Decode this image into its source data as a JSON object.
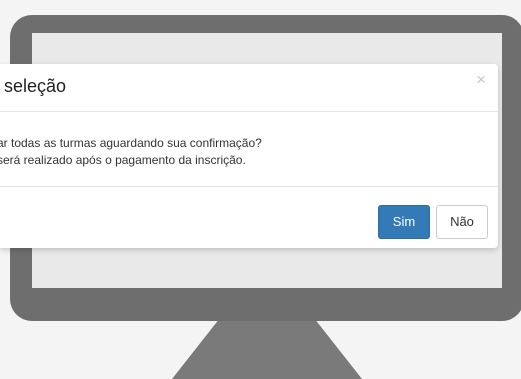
{
  "dialog": {
    "title": "r seleção",
    "close_symbol": "×",
    "body_line1": "ar todas as turmas aguardando sua confirmação?",
    "body_line2": "será realizado após o pagamento da inscrição.",
    "confirm_label": "Sim",
    "cancel_label": "Não"
  },
  "colors": {
    "primary_button": "#337ab7",
    "monitor_frame": "#6e6e6e"
  }
}
